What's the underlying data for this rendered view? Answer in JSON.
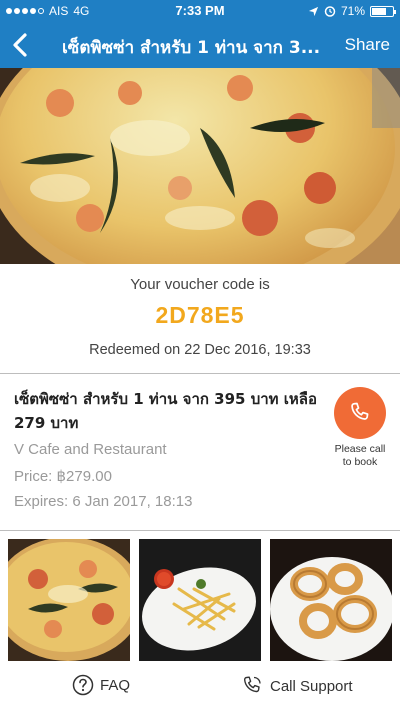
{
  "status_bar": {
    "carrier": "AIS",
    "network": "4G",
    "time": "7:33 PM",
    "battery": "71%",
    "battery_level": 0.71
  },
  "nav": {
    "title": "เซ็ตพิซซ่า สำหรับ 1 ท่าน จาก 3...",
    "share_label": "Share",
    "back_icon": "chevron-left-icon"
  },
  "voucher": {
    "label": "Your voucher code is",
    "code": "2D78E5",
    "redeemed": "Redeemed on 22 Dec 2016, 19:33"
  },
  "deal": {
    "title": "เซ็ตพิซซ่า สำหรับ 1 ท่าน จาก 395 บาท เหลือ 279 บาท",
    "merchant": "V Cafe and Restaurant",
    "price": "Price: ฿279.00",
    "expires": "Expires: 6 Jan 2017, 18:13",
    "call_label": "Please call to book"
  },
  "gallery": [
    {
      "name": "pizza-thumbnail"
    },
    {
      "name": "french-fries-thumbnail"
    },
    {
      "name": "onion-rings-thumbnail"
    }
  ],
  "footer": {
    "faq_label": "FAQ",
    "support_label": "Call Support"
  },
  "colors": {
    "primary": "#1f7fc4",
    "voucher_code": "#f2a81d",
    "call_button": "#f06b36",
    "muted_text": "#9a9a9a"
  }
}
